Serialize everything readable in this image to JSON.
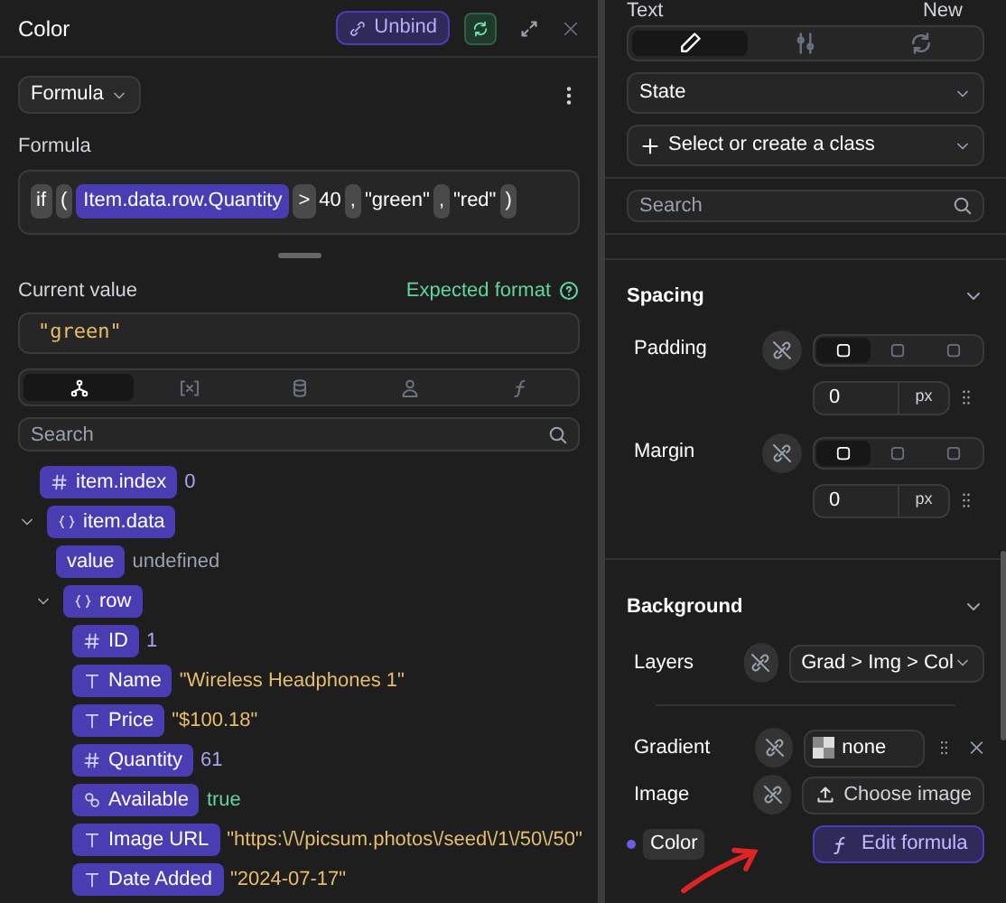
{
  "formula_panel": {
    "title": "Color",
    "unbind_button": "Unbind",
    "mode_dropdown": "Formula",
    "formula_label": "Formula",
    "formula_tokens": [
      {
        "kind": "op",
        "text": "if"
      },
      {
        "kind": "op",
        "text": "("
      },
      {
        "kind": "var",
        "text": "Item.data.row.Quantity"
      },
      {
        "kind": "op",
        "text": ">"
      },
      {
        "kind": "plain",
        "text": "40"
      },
      {
        "kind": "op",
        "text": ","
      },
      {
        "kind": "plain",
        "text": "\"green\""
      },
      {
        "kind": "op",
        "text": ","
      },
      {
        "kind": "plain",
        "text": "\"red\""
      },
      {
        "kind": "op",
        "text": ")"
      }
    ],
    "current_value_label": "Current value",
    "expected_format_link": "Expected format",
    "current_value": "\"green\"",
    "tabs": [
      {
        "selected": true
      },
      {
        "selected": false
      },
      {
        "selected": false
      },
      {
        "selected": false
      },
      {
        "selected": false
      }
    ],
    "search": {
      "placeholder": "Search"
    },
    "tree": [
      {
        "kind": "number",
        "name": "item.index",
        "value": "0"
      },
      {
        "kind": "object",
        "name": "item.data",
        "expanded": true,
        "children": [
          {
            "kind": "plain",
            "name": "value",
            "value": "undefined"
          },
          {
            "kind": "object",
            "name": "row",
            "expanded": true,
            "children": [
              {
                "kind": "number",
                "name": "ID",
                "value": "1"
              },
              {
                "kind": "text",
                "name": "Name",
                "value": "\"Wireless Headphones 1\""
              },
              {
                "kind": "text",
                "name": "Price",
                "value": "\"$100.18\""
              },
              {
                "kind": "number",
                "name": "Quantity",
                "value": "61"
              },
              {
                "kind": "boolean",
                "name": "Available",
                "value": "true"
              },
              {
                "kind": "text",
                "name": "Image URL",
                "value": "\"https:\\/\\/picsum.photos\\/seed\\/1\\/50\\/50\""
              },
              {
                "kind": "text",
                "name": "Date Added",
                "value": "\"2024-07-17\""
              }
            ]
          }
        ]
      }
    ]
  },
  "style_panel": {
    "element_title": "Text",
    "new_button": "New",
    "tabs": [
      {
        "selected": true
      },
      {
        "selected": false
      },
      {
        "selected": false
      }
    ],
    "state_select": "State",
    "class_select": "Select or create a class",
    "search": {
      "placeholder": "Search"
    },
    "spacing": {
      "title": "Spacing",
      "expanded": true,
      "rows": [
        {
          "label": "Padding",
          "segments": [
            {
              "selected": true
            },
            {
              "selected": false
            },
            {
              "selected": false
            }
          ],
          "value": "0",
          "unit": "px"
        },
        {
          "label": "Margin",
          "segments": [
            {
              "selected": true
            },
            {
              "selected": false
            },
            {
              "selected": false
            }
          ],
          "value": "0",
          "unit": "px"
        }
      ]
    },
    "background": {
      "title": "Background",
      "expanded": true,
      "layers_label": "Layers",
      "layers_value": "Grad > Img > Col",
      "gradient_label": "Gradient",
      "gradient_value": "none",
      "image_label": "Image",
      "image_button": "Choose image",
      "color_label": "Color",
      "color_bound": true,
      "color_button": "Edit formula"
    }
  }
}
